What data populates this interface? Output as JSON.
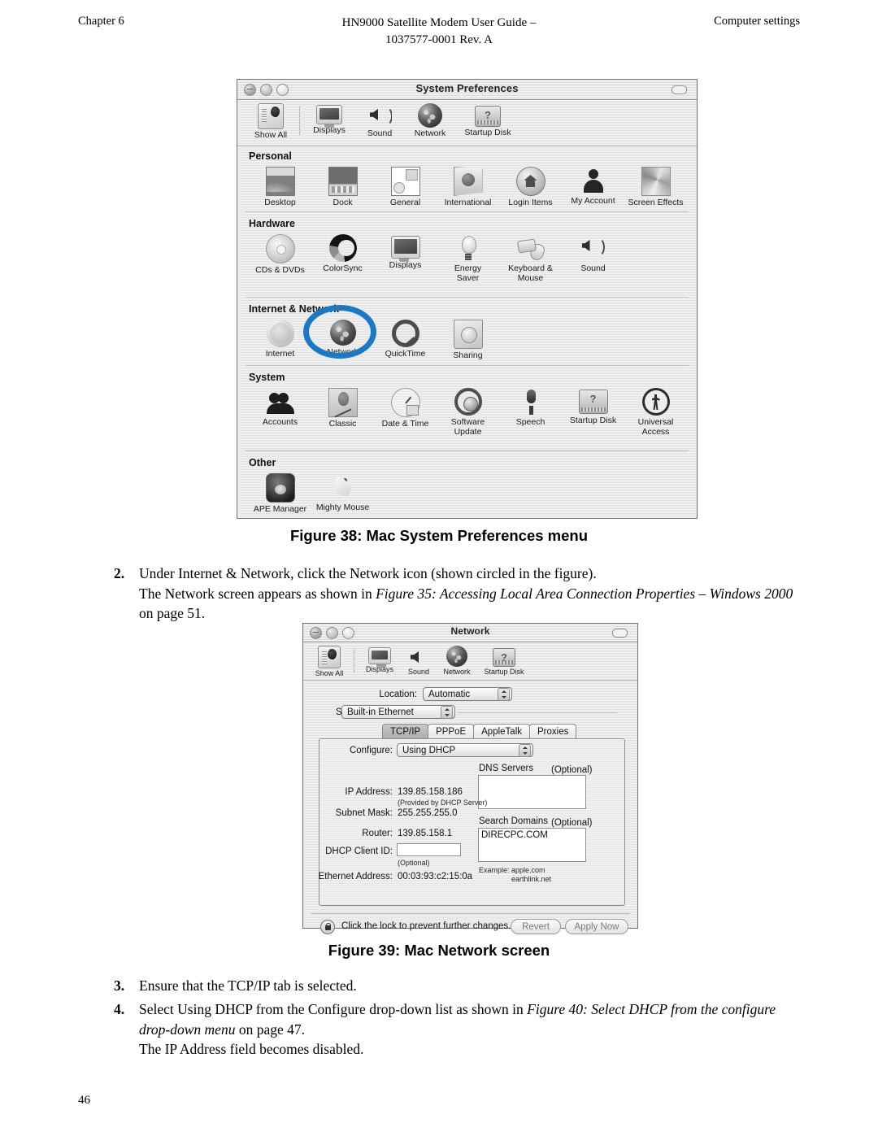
{
  "page": {
    "running_head_left": "Chapter 6",
    "running_head_center_line1": "HN9000 Satellite Modem User Guide –",
    "running_head_center_line2": "1037577-0001 Rev. A",
    "running_head_right": "Computer settings",
    "page_number": "46"
  },
  "accent": {
    "annotation_circle_color": "#1a79c6"
  },
  "figure38": {
    "caption": "Figure 38: Mac System Preferences menu",
    "window": {
      "title": "System Preferences",
      "toolbar": [
        {
          "label": "Show All",
          "icon": "show-all-icon"
        },
        {
          "label": "Displays",
          "icon": "displays-icon"
        },
        {
          "label": "Sound",
          "icon": "sound-icon"
        },
        {
          "label": "Network",
          "icon": "network-globe-icon"
        },
        {
          "label": "Startup Disk",
          "icon": "startup-disk-icon"
        }
      ],
      "sections": [
        {
          "heading": "Personal",
          "items": [
            {
              "label": "Desktop",
              "icon": "desktop-icon"
            },
            {
              "label": "Dock",
              "icon": "dock-icon"
            },
            {
              "label": "General",
              "icon": "general-icon"
            },
            {
              "label": "International",
              "icon": "international-flag-icon"
            },
            {
              "label": "Login Items",
              "icon": "login-items-icon"
            },
            {
              "label": "My Account",
              "icon": "my-account-icon"
            },
            {
              "label": "Screen Effects",
              "icon": "screen-effects-icon"
            }
          ]
        },
        {
          "heading": "Hardware",
          "items": [
            {
              "label": "CDs & DVDs",
              "icon": "cds-dvds-icon"
            },
            {
              "label": "ColorSync",
              "icon": "colorsync-icon"
            },
            {
              "label": "Displays",
              "icon": "displays-icon"
            },
            {
              "label": "Energy\nSaver",
              "icon": "energy-saver-icon"
            },
            {
              "label": "Keyboard &\nMouse",
              "icon": "keyboard-mouse-icon"
            },
            {
              "label": "Sound",
              "icon": "sound-icon"
            }
          ]
        },
        {
          "heading": "Internet & Network",
          "items": [
            {
              "label": "Internet",
              "icon": "internet-icon"
            },
            {
              "label": "Network",
              "icon": "network-globe-icon",
              "annotated": true
            },
            {
              "label": "QuickTime",
              "icon": "quicktime-icon"
            },
            {
              "label": "Sharing",
              "icon": "sharing-icon"
            }
          ]
        },
        {
          "heading": "System",
          "items": [
            {
              "label": "Accounts",
              "icon": "accounts-icon"
            },
            {
              "label": "Classic",
              "icon": "classic-icon"
            },
            {
              "label": "Date & Time",
              "icon": "date-time-icon"
            },
            {
              "label": "Software\nUpdate",
              "icon": "software-update-icon"
            },
            {
              "label": "Speech",
              "icon": "speech-icon"
            },
            {
              "label": "Startup Disk",
              "icon": "startup-disk-icon"
            },
            {
              "label": "Universal\nAccess",
              "icon": "universal-access-icon"
            }
          ]
        },
        {
          "heading": "Other",
          "items": [
            {
              "label": "APE Manager",
              "icon": "ape-manager-icon"
            },
            {
              "label": "Mighty Mouse",
              "icon": "mighty-mouse-icon"
            }
          ]
        }
      ]
    }
  },
  "step2": {
    "number": "2.",
    "line1": "Under Internet & Network, click the Network icon (shown circled in the figure).",
    "line2_plain_a": "The Network screen appears as shown in ",
    "line2_italic": "Figure 35: Accessing Local Area Connection Properties – Windows 2000",
    "line3": "on page 51."
  },
  "figure39": {
    "caption": "Figure 39: Mac Network screen",
    "window": {
      "title": "Network",
      "toolbar": [
        {
          "label": "Show All",
          "icon": "show-all-icon"
        },
        {
          "label": "Displays",
          "icon": "displays-icon"
        },
        {
          "label": "Sound",
          "icon": "sound-icon"
        },
        {
          "label": "Network",
          "icon": "network-globe-icon"
        },
        {
          "label": "Startup Disk",
          "icon": "startup-disk-icon"
        }
      ],
      "location_label": "Location:",
      "location_value": "Automatic",
      "show_label": "Show:",
      "show_value": "Built-in Ethernet",
      "tabs": [
        {
          "label": "TCP/IP",
          "active": true
        },
        {
          "label": "PPPoE",
          "active": false
        },
        {
          "label": "AppleTalk",
          "active": false
        },
        {
          "label": "Proxies",
          "active": false
        }
      ],
      "configure_label": "Configure:",
      "configure_value": "Using DHCP",
      "ip_address_label": "IP Address:",
      "ip_address_value": "139.85.158.186",
      "ip_address_note": "(Provided by DHCP Server)",
      "subnet_mask_label": "Subnet Mask:",
      "subnet_mask_value": "255.255.255.0",
      "router_label": "Router:",
      "router_value": "139.85.158.1",
      "dhcp_client_id_label": "DHCP Client ID:",
      "dhcp_client_id_value": "",
      "dhcp_client_id_note": "(Optional)",
      "ethernet_address_label": "Ethernet Address:",
      "ethernet_address_value": "00:03:93:c2:15:0a",
      "dns_servers_label": "DNS Servers",
      "dns_servers_optional": "(Optional)",
      "dns_servers_value": "",
      "search_domains_label": "Search Domains",
      "search_domains_optional": "(Optional)",
      "search_domains_value": "DIRECPC.COM",
      "example_label": "Example:",
      "example_line1": "apple.com",
      "example_line2": "earthlink.net",
      "lock_text": "Click the lock to prevent further changes.",
      "revert_button": "Revert",
      "apply_button": "Apply Now"
    }
  },
  "step3": {
    "number": "3.",
    "line1": "Ensure that the TCP/IP tab is selected."
  },
  "step4": {
    "number": "4.",
    "line1_plain_a": "Select Using DHCP from the Configure drop-down list as shown in ",
    "line1_italic": "Figure 40: Select DHCP from the configure",
    "line2_italic": "drop-down menu",
    "line2_plain": " on page 47.",
    "line3": "The IP Address field becomes disabled."
  }
}
